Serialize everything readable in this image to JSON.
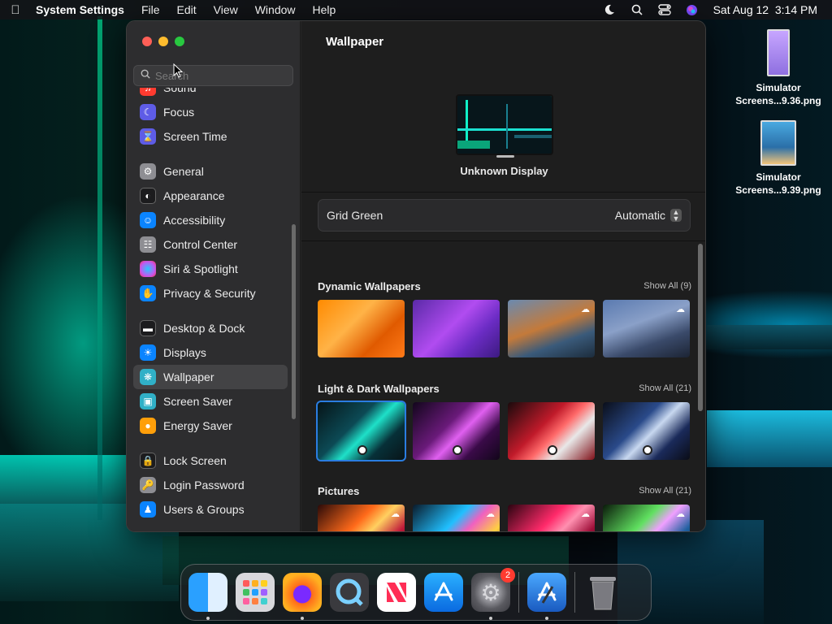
{
  "menubar": {
    "app_name": "System Settings",
    "menus": [
      "File",
      "Edit",
      "View",
      "Window",
      "Help"
    ],
    "datetime": "Sat Aug 12  3:14 PM"
  },
  "sidebar": {
    "search_placeholder": "Search",
    "groups": [
      [
        {
          "label": "Sound",
          "icon": "speaker-icon",
          "color": "#ff3b30"
        },
        {
          "label": "Focus",
          "icon": "moon-icon",
          "color": "#5e5ce6"
        },
        {
          "label": "Screen Time",
          "icon": "hourglass-icon",
          "color": "#5e5ce6"
        }
      ],
      [
        {
          "label": "General",
          "icon": "gear-icon",
          "color": "#8e8e93"
        },
        {
          "label": "Appearance",
          "icon": "appearance-icon",
          "color": "#1c1c1e"
        },
        {
          "label": "Accessibility",
          "icon": "accessibility-icon",
          "color": "#0a84ff"
        },
        {
          "label": "Control Center",
          "icon": "control-center-icon",
          "color": "#8e8e93"
        },
        {
          "label": "Siri & Spotlight",
          "icon": "siri-icon",
          "color": "#bf5af2"
        },
        {
          "label": "Privacy & Security",
          "icon": "hand-icon",
          "color": "#0a84ff"
        }
      ],
      [
        {
          "label": "Desktop & Dock",
          "icon": "dock-icon",
          "color": "#1c1c1e"
        },
        {
          "label": "Displays",
          "icon": "sun-icon",
          "color": "#0a84ff"
        },
        {
          "label": "Wallpaper",
          "icon": "wallpaper-icon",
          "color": "#30b0c7",
          "selected": true
        },
        {
          "label": "Screen Saver",
          "icon": "screen-saver-icon",
          "color": "#30b0c7"
        },
        {
          "label": "Energy Saver",
          "icon": "battery-icon",
          "color": "#ff9f0a"
        }
      ],
      [
        {
          "label": "Lock Screen",
          "icon": "lock-icon",
          "color": "#1c1c1e"
        },
        {
          "label": "Login Password",
          "icon": "padlock-icon",
          "color": "#8e8e93"
        },
        {
          "label": "Users & Groups",
          "icon": "users-icon",
          "color": "#0a84ff"
        }
      ]
    ]
  },
  "main": {
    "title": "Wallpaper",
    "display_label": "Unknown Display",
    "wallpaper_name": "Grid Green",
    "mode": "Automatic",
    "sections": [
      {
        "title": "Dynamic Wallpapers",
        "show_all": "Show All (9)"
      },
      {
        "title": "Light & Dark Wallpapers",
        "show_all": "Show All (21)"
      },
      {
        "title": "Pictures",
        "show_all": "Show All (21)"
      }
    ]
  },
  "desktop": {
    "files": [
      {
        "name_line1": "Simulator",
        "name_line2": "Screens...9.36.png"
      },
      {
        "name_line1": "Simulator",
        "name_line2": "Screens...9.39.png"
      }
    ]
  },
  "dock": {
    "apps": [
      "Finder",
      "Launchpad",
      "Firefox",
      "QuickTime Player",
      "News",
      "App Store",
      "System Settings",
      "Xcode",
      "Trash"
    ],
    "settings_badge": "2"
  }
}
